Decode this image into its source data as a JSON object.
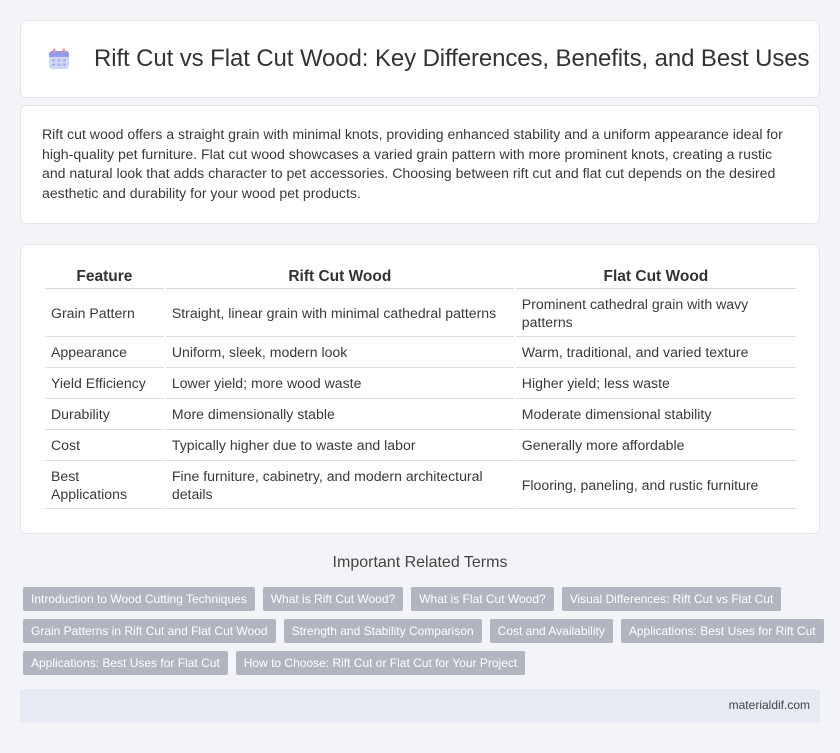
{
  "header": {
    "title": "Rift Cut vs Flat Cut Wood: Key Differences, Benefits, and Best Uses",
    "icon": "calendar-icon"
  },
  "intro": {
    "text": "Rift cut wood offers a straight grain with minimal knots, providing enhanced stability and a uniform appearance ideal for high-quality pet furniture. Flat cut wood showcases a varied grain pattern with more prominent knots, creating a rustic and natural look that adds character to pet accessories. Choosing between rift cut and flat cut depends on the desired aesthetic and durability for your wood pet products."
  },
  "table": {
    "headers": [
      "Feature",
      "Rift Cut Wood",
      "Flat Cut Wood"
    ],
    "rows": [
      [
        "Grain Pattern",
        "Straight, linear grain with minimal cathedral patterns",
        "Prominent cathedral grain with wavy patterns"
      ],
      [
        "Appearance",
        "Uniform, sleek, modern look",
        "Warm, traditional, and varied texture"
      ],
      [
        "Yield Efficiency",
        "Lower yield; more wood waste",
        "Higher yield; less waste"
      ],
      [
        "Durability",
        "More dimensionally stable",
        "Moderate dimensional stability"
      ],
      [
        "Cost",
        "Typically higher due to waste and labor",
        "Generally more affordable"
      ],
      [
        "Best Applications",
        "Fine furniture, cabinetry, and modern architectural details",
        "Flooring, paneling, and rustic furniture"
      ]
    ]
  },
  "related": {
    "heading": "Important Related Terms",
    "tags": [
      "Introduction to Wood Cutting Techniques",
      "What is Rift Cut Wood?",
      "What is Flat Cut Wood?",
      "Visual Differences: Rift Cut vs Flat Cut",
      "Grain Patterns in Rift Cut and Flat Cut Wood",
      "Strength and Stability Comparison",
      "Cost and Availability",
      "Applications: Best Uses for Rift Cut",
      "Applications: Best Uses for Flat Cut",
      "How to Choose: Rift Cut or Flat Cut for Your Project"
    ]
  },
  "footer": {
    "site": "materialdif.com"
  },
  "colors": {
    "tag_bg": "#b0b5c0",
    "footer_bg": "#e6eaf5",
    "page_bg": "#f3f4f8"
  }
}
